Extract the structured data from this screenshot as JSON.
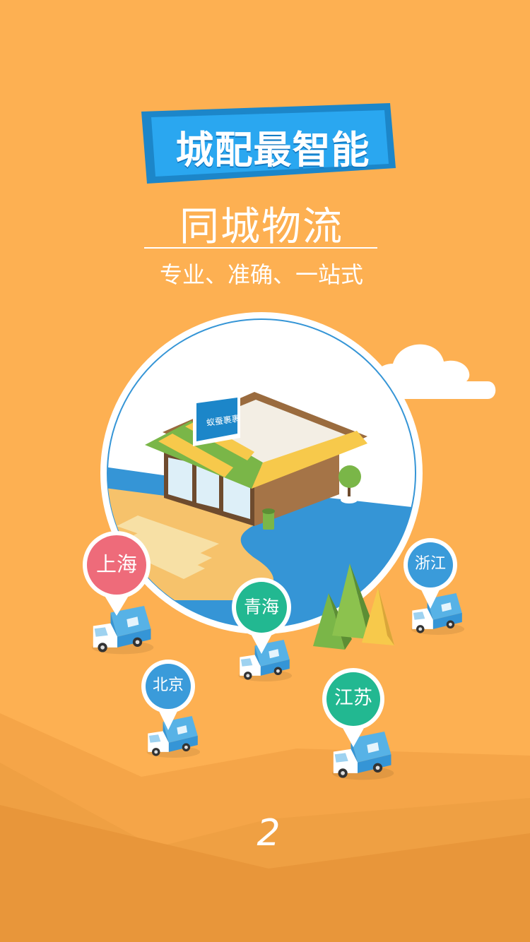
{
  "header": {
    "title": "城配最智能",
    "subtitle": "同城物流",
    "tagline": "专业、准确、一站式"
  },
  "store": {
    "sign_text": "蚁蚕裹裹"
  },
  "pins": [
    {
      "label": "上海",
      "color": "#EE6B7A"
    },
    {
      "label": "青海",
      "color": "#22B891"
    },
    {
      "label": "浙江",
      "color": "#3A9BDA"
    },
    {
      "label": "北京",
      "color": "#3A9BDA"
    },
    {
      "label": "江苏",
      "color": "#22B891"
    }
  ],
  "page_indicator": "2",
  "colors": {
    "background": "#FDB052",
    "banner": "#2AA7F0",
    "road": "#3595D6",
    "truck": "#57B2E6"
  }
}
